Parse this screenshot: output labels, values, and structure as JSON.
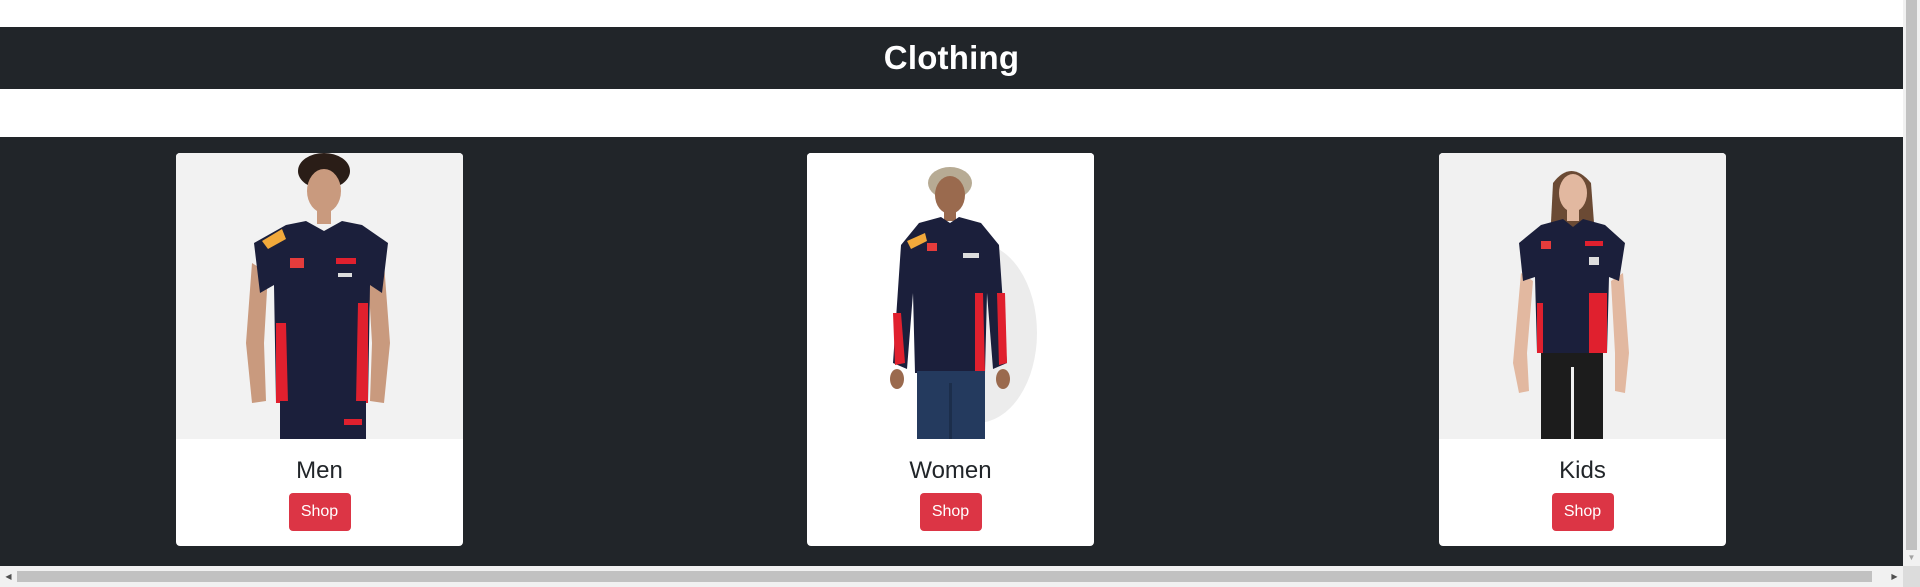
{
  "page": {
    "heading": "Clothing"
  },
  "categories": [
    {
      "label": "Men",
      "button_label": "Shop",
      "image_alt": "man wearing navy team t-shirt"
    },
    {
      "label": "Women",
      "button_label": "Shop",
      "image_alt": "woman wearing navy team jacket"
    },
    {
      "label": "Kids",
      "button_label": "Shop",
      "image_alt": "girl wearing navy team t-shirt"
    }
  ],
  "colors": {
    "dark_bg": "#212529",
    "button_red": "#dc3545",
    "shirt_navy": "#1b1f3b",
    "accent_red": "#e0202e"
  },
  "icons": {
    "scroll_up": "triangle-up-icon",
    "scroll_down": "triangle-down-icon",
    "scroll_left": "triangle-left-icon",
    "scroll_right": "triangle-right-icon"
  }
}
